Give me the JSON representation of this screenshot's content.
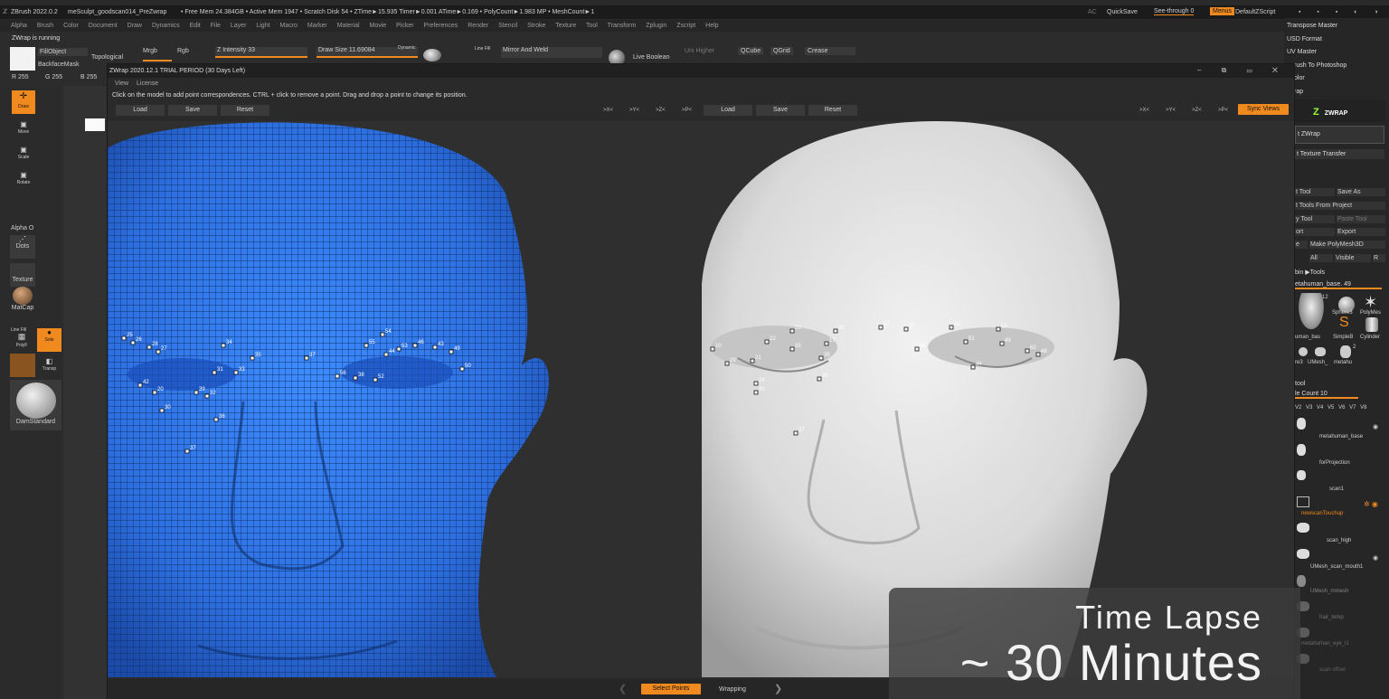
{
  "app": {
    "title": "ZBrush 2022.0.2",
    "doc": "meSculpt_goodscan014_PreZwrap",
    "stats": "• Free Mem 24.384GB • Active Mem 1947 • Scratch Disk 54 • ZTime►15.935 Timer►0.001 ATime►0.169 • PolyCount►1.983 MP • MeshCount►1",
    "ac": "AC",
    "quicksave": "QuickSave",
    "seethrough": "See-through  0",
    "menus": "Menus",
    "script": "DefaultZScript"
  },
  "menu": [
    "Alpha",
    "Brush",
    "Color",
    "Document",
    "Draw",
    "Dynamics",
    "Edit",
    "File",
    "Layer",
    "Light",
    "Macro",
    "Marker",
    "Material",
    "Movie",
    "Picker",
    "Preferences",
    "Render",
    "Stencil",
    "Stroke",
    "Texture",
    "Tool",
    "Transform",
    "Zplugin",
    "Zscript",
    "Help"
  ],
  "toolbar": {
    "status": "ZWrap is running",
    "fill_object": "FillObject",
    "backface": "BackfaceMask",
    "topological": "Topological",
    "mrgb": "Mrgb",
    "rgb": "Rgb",
    "z_intensity": "Z Intensity 33",
    "draw_size": "Draw Size 11.69084",
    "dynamic": "Dynamic",
    "line_fill": "Line Fill",
    "mirror_weld": "Mirror And Weld",
    "live_boolean": "Live Boolean",
    "unihigher": "Uni Higher",
    "qcube": "QCube",
    "qgrid": "QGrid",
    "crease": "Crease",
    "r": "R 255",
    "g": "G 255",
    "b": "B 255"
  },
  "leftshelf": {
    "draw": "Draw",
    "move": "Move",
    "scale": "Scale",
    "rotate": "Rotate",
    "alpha": "Alpha O",
    "dots": "Dots",
    "texture": "Texture",
    "matcap": "MatCap",
    "linefill": "Line Fill",
    "polyf": "PolyF",
    "solo": "Solo",
    "transp": "Transp",
    "brush": "DamStandard"
  },
  "right": {
    "items": [
      "Transpose Master",
      "USD Format",
      "UV Master",
      "rush To Photoshop",
      "olor",
      "rap"
    ],
    "zwrap_logo": "ZWRAP",
    "start": "t ZWrap",
    "texture_transfer": "t Texture Transfer",
    "tool_rows": [
      [
        "t Tool",
        "Save As"
      ],
      [
        "t Tools From Project",
        ""
      ],
      [
        "y Tool",
        "Paste Tool"
      ],
      [
        "ort",
        "Export"
      ],
      [
        "e",
        "Make PolyMesh3D"
      ],
      [
        "",
        "All",
        "Visible",
        "R"
      ]
    ],
    "subtools_label": "bin ▶Tools",
    "mh_label": "etahuman_base. 49",
    "thumb_labels": [
      "uman_bas",
      "Sphere3",
      "PolyMes",
      "SimpleB",
      "Cylinder",
      "re3",
      "UMesh_",
      "metahu"
    ],
    "counts": [
      "12",
      "2"
    ],
    "subtool": "tool",
    "count": "le Count 10",
    "vis": [
      "V2",
      "V3",
      "V4",
      "V5",
      "V6",
      "V7",
      "V8"
    ],
    "subtools": [
      "metahuman_base",
      "forProjection",
      "scan1",
      "newscanTouchup",
      "scan_high",
      "UMesh_scan_mouth1",
      "UMesh_rnmesh",
      "hair_temp",
      "metahuman_eye_l1",
      "scan offset"
    ]
  },
  "zwrap": {
    "title": "ZWrap 2020.12.1  TRIAL PERIOD (30 Days Left)",
    "menu_view": "View",
    "menu_license": "License",
    "hint": "Click on the model to add point correspondences. CTRL + click to remove a point. Drag and drop a point to change its position.",
    "load": "Load",
    "save": "Save",
    "reset": "Reset",
    "axes": [
      ">X<",
      ">Y<",
      ">Z<",
      ">P<"
    ],
    "sync": "Sync Views",
    "select_points": "Select Points",
    "wrapping": "Wrapping"
  },
  "overlay": {
    "line1": "Time Lapse",
    "line2": "~ 30 Minutes"
  },
  "colors": {
    "accent": "#f08a1e",
    "blue_mesh": "#2f78ea",
    "bg": "#2a2a2a"
  },
  "points_left": [
    "25",
    "26",
    "28",
    "27",
    "34",
    "31",
    "20",
    "35",
    "37",
    "56",
    "55",
    "54",
    "53",
    "46",
    "44",
    "43",
    "49",
    "38",
    "52",
    "50",
    "39",
    "36",
    "30",
    "33",
    "32",
    "37",
    "42"
  ],
  "points_right": [
    "24",
    "23",
    "22",
    "21",
    "27",
    "28",
    "17",
    "10",
    "30",
    "35",
    "33",
    "57",
    "58",
    "55",
    "51",
    "53",
    "49",
    "62",
    "48",
    "44",
    "36",
    "37",
    "29"
  ]
}
